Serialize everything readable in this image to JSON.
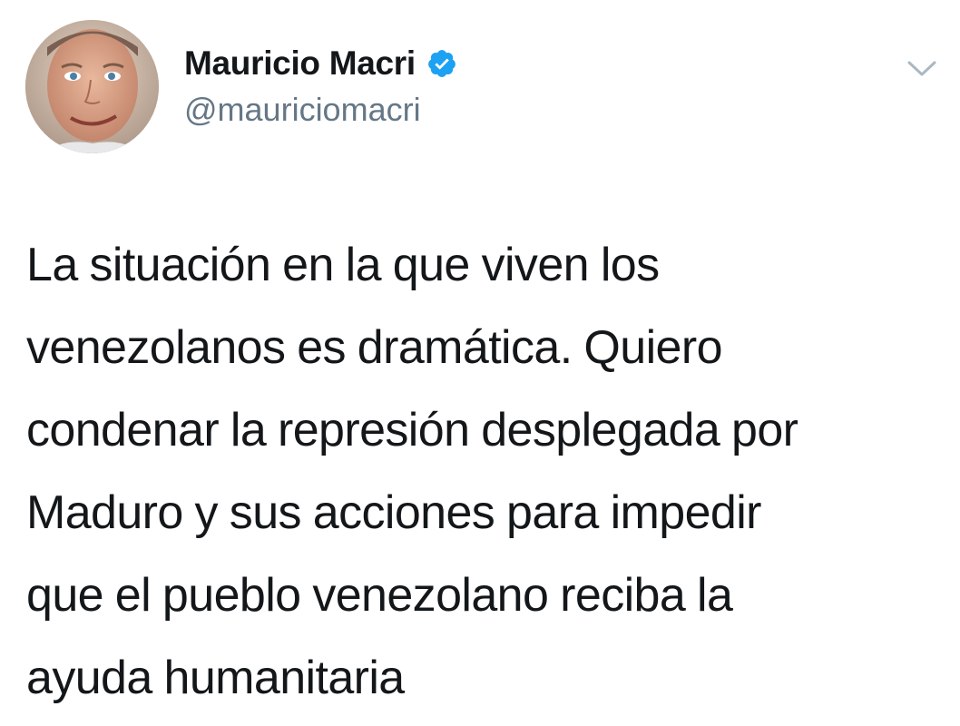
{
  "tweet": {
    "author": {
      "name": "Mauricio Macri",
      "handle": "@mauriciomacri",
      "verified": true,
      "verified_color": "#1da1f2"
    },
    "text_lines": [
      "La situación en la que viven los",
      "venezolanos es dramática. Quiero",
      "condenar la represión desplegada por",
      "Maduro y sus acciones para impedir",
      "que el pueblo venezolano reciba la",
      "ayuda humanitaria"
    ],
    "menu_icon": "chevron-down-icon"
  },
  "colors": {
    "text": "#14171a",
    "secondary": "#657786",
    "background": "#ffffff"
  }
}
